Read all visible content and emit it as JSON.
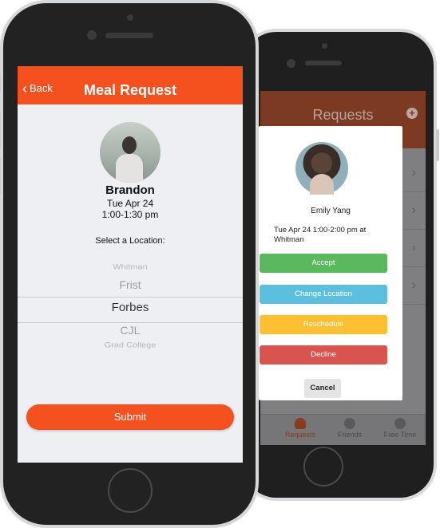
{
  "colors": {
    "brand": "#f4511e",
    "accept": "#5cb85c",
    "change_location": "#5bc0de",
    "reschedule": "#ffbf33",
    "decline": "#d9534f"
  },
  "front": {
    "header": {
      "back_label": "Back",
      "title": "Meal Request"
    },
    "profile": {
      "name": "Brandon",
      "date": "Tue Apr 24",
      "time": "1:00-1:30 pm"
    },
    "select_label": "Select a Location:",
    "locations": [
      "Whitman",
      "Frist",
      "Forbes",
      "CJL",
      "Grad College"
    ],
    "selected_location": "Forbes",
    "submit_label": "Submit",
    "icons": [
      "chevron-left-icon",
      "avatar"
    ]
  },
  "back": {
    "header": {
      "title": "Requests"
    },
    "tabs": [
      {
        "label": "Requests",
        "icon": "bell-icon",
        "active": true
      },
      {
        "label": "Friends",
        "icon": "people-icon",
        "active": false
      },
      {
        "label": "Free Time",
        "icon": "clock-icon",
        "active": false
      }
    ],
    "modal": {
      "name": "Emily Yang",
      "time_text": "Tue Apr 24 1:00-2:00 pm at Whitman",
      "accept_label": "Accept",
      "change_label": "Change Location",
      "reschedule_label": "Reschedule",
      "decline_label": "Decline",
      "cancel_label": "Cancel"
    }
  }
}
